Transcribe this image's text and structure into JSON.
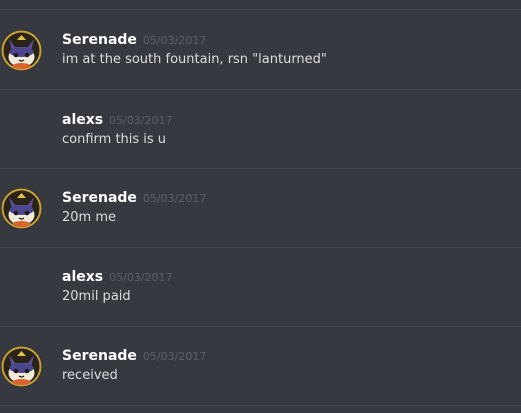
{
  "messages": [
    {
      "author": "Serenade",
      "timestamp": "05/03/2017",
      "text": "im at the south fountain, rsn \"lanturned\"",
      "has_avatar": true
    },
    {
      "author": "alexs",
      "timestamp": "05/03/2017",
      "text": "confirm this is u",
      "has_avatar": false
    },
    {
      "author": "Serenade",
      "timestamp": "05/03/2017",
      "text": "20m me",
      "has_avatar": true
    },
    {
      "author": "alexs",
      "timestamp": "05/03/2017",
      "text": "20mil paid",
      "has_avatar": false
    },
    {
      "author": "Serenade",
      "timestamp": "05/03/2017",
      "text": "received",
      "has_avatar": true
    }
  ],
  "colors": {
    "background": "#36393f",
    "divider": "#42454a",
    "author": "#ffffff",
    "timestamp": "#5c5f64",
    "text": "#dcddde"
  },
  "icons": {
    "avatar": "cat-avatar-icon"
  }
}
